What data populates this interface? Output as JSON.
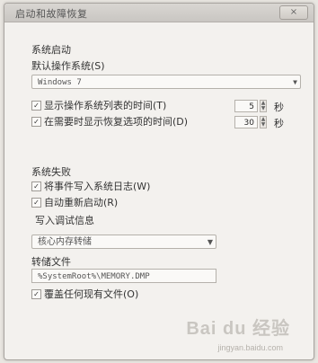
{
  "window": {
    "title": "启动和故障恢复",
    "close_label": "×"
  },
  "system_startup": {
    "section_label": "系统启动",
    "default_os_label": "默认操作系统(S)",
    "default_os_value": "Windows 7",
    "show_os_list": {
      "label": "显示操作系统列表的时间(T)",
      "checked": true,
      "value": "5",
      "unit": "秒"
    },
    "show_recovery": {
      "label": "在需要时显示恢复选项的时间(D)",
      "checked": true,
      "value": "30",
      "unit": "秒"
    }
  },
  "system_failure": {
    "section_label": "系统失败",
    "write_event_log": {
      "label": "将事件写入系统日志(W)",
      "checked": true
    },
    "auto_restart": {
      "label": "自动重新启动(R)",
      "checked": true
    },
    "debug_info_label": "写入调试信息",
    "debug_info_value": "核心内存转储",
    "dump_file_label": "转储文件",
    "dump_file_value": "%SystemRoot%\\MEMORY.DMP",
    "overwrite": {
      "label": "覆盖任何现有文件(O)",
      "checked": true
    }
  },
  "watermark": {
    "brand": "Bai du 经验",
    "url": "jingyan.baidu.com"
  },
  "icons": {
    "checkbox_check": "✓",
    "dropdown_arrow": "▼",
    "spin_up": "▲",
    "spin_down": "▼"
  }
}
